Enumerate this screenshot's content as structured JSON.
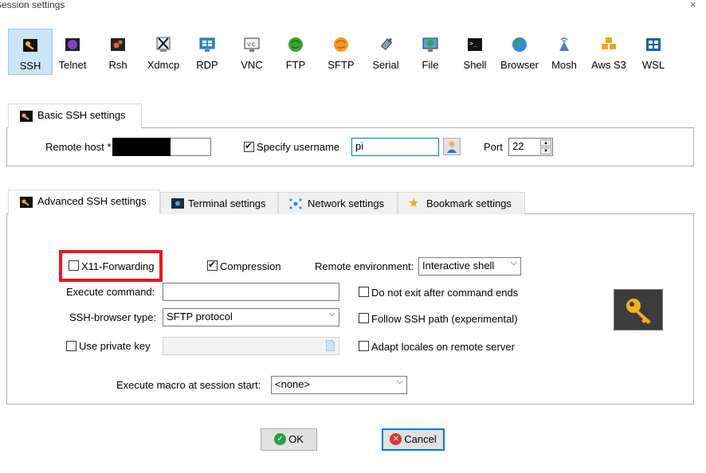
{
  "window": {
    "title": "Session settings",
    "close_glyph": "×"
  },
  "session_types": [
    {
      "label": "SSH",
      "icon": "ssh-key-icon",
      "selected": true
    },
    {
      "label": "Telnet",
      "icon": "telnet-icon"
    },
    {
      "label": "Rsh",
      "icon": "rsh-icon"
    },
    {
      "label": "Xdmcp",
      "icon": "xdmcp-icon"
    },
    {
      "label": "RDP",
      "icon": "rdp-icon"
    },
    {
      "label": "VNC",
      "icon": "vnc-icon"
    },
    {
      "label": "FTP",
      "icon": "ftp-icon"
    },
    {
      "label": "SFTP",
      "icon": "sftp-icon"
    },
    {
      "label": "Serial",
      "icon": "serial-icon"
    },
    {
      "label": "File",
      "icon": "file-icon"
    },
    {
      "label": "Shell",
      "icon": "shell-icon"
    },
    {
      "label": "Browser",
      "icon": "browser-icon"
    },
    {
      "label": "Mosh",
      "icon": "mosh-icon"
    },
    {
      "label": "Aws S3",
      "icon": "aws-s3-icon"
    },
    {
      "label": "WSL",
      "icon": "wsl-icon"
    }
  ],
  "basic": {
    "tab_label": "Basic SSH settings",
    "remote_host_label": "Remote host *",
    "remote_host_value": "",
    "specify_username_label": "Specify username",
    "specify_username_checked": true,
    "username_value": "pi",
    "port_label": "Port",
    "port_value": "22"
  },
  "advanced_tabs": [
    {
      "label": "Advanced SSH settings",
      "active": true
    },
    {
      "label": "Terminal settings"
    },
    {
      "label": "Network settings"
    },
    {
      "label": "Bookmark settings"
    }
  ],
  "advanced": {
    "x11_label": "X11-Forwarding",
    "x11_checked": false,
    "compression_label": "Compression",
    "compression_checked": true,
    "remote_env_label": "Remote environment:",
    "remote_env_value": "Interactive shell",
    "execute_command_label": "Execute command:",
    "execute_command_value": "",
    "do_not_exit_label": "Do not exit after command ends",
    "do_not_exit_checked": false,
    "browser_type_label": "SSH-browser type:",
    "browser_type_value": "SFTP protocol",
    "follow_path_label": "Follow SSH path (experimental)",
    "follow_path_checked": false,
    "use_private_key_label": "Use private key",
    "use_private_key_checked": false,
    "adapt_locales_label": "Adapt locales on remote server",
    "adapt_locales_checked": false,
    "macro_label": "Execute macro at session start:",
    "macro_value": "<none>"
  },
  "buttons": {
    "ok": "OK",
    "cancel": "Cancel"
  },
  "colors": {
    "accent": "#0078d7",
    "highlight": "#e11b22",
    "selected_bg": "#cce4f7",
    "ok_green": "#2e9e44",
    "cancel_red": "#d9372d"
  }
}
